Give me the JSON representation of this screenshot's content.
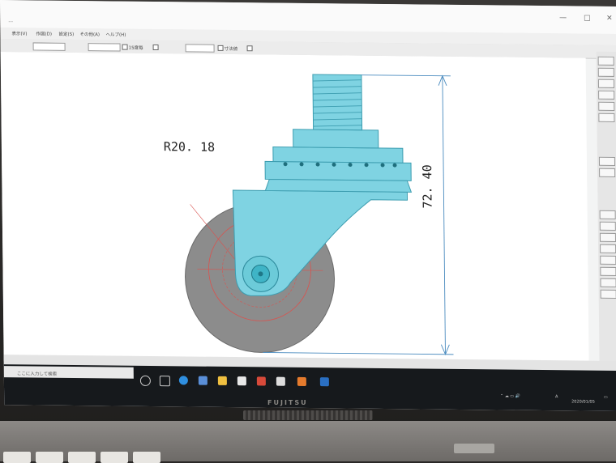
{
  "window": {
    "title": "...",
    "controls": [
      "—",
      "□",
      "✕"
    ]
  },
  "menu": {
    "items": [
      "表示(V)",
      "作図(D)",
      "設定(S)",
      "その他(A)",
      "ヘルプ(H)"
    ]
  },
  "toolbar": {
    "check1": "15度毎",
    "check2": "寸法値"
  },
  "drawing": {
    "radius_label": "R20. 18",
    "height_label": "72. 40",
    "colors": {
      "body": "#7fd3e2",
      "wheel": "#8c8c8c",
      "construction": "#d9534f",
      "dimension": "#4a8bbf"
    }
  },
  "taskbar": {
    "search_placeholder": "ここに入力して検索",
    "date": "2020/01/05"
  },
  "laptop": {
    "brand": "FUJITSU"
  }
}
